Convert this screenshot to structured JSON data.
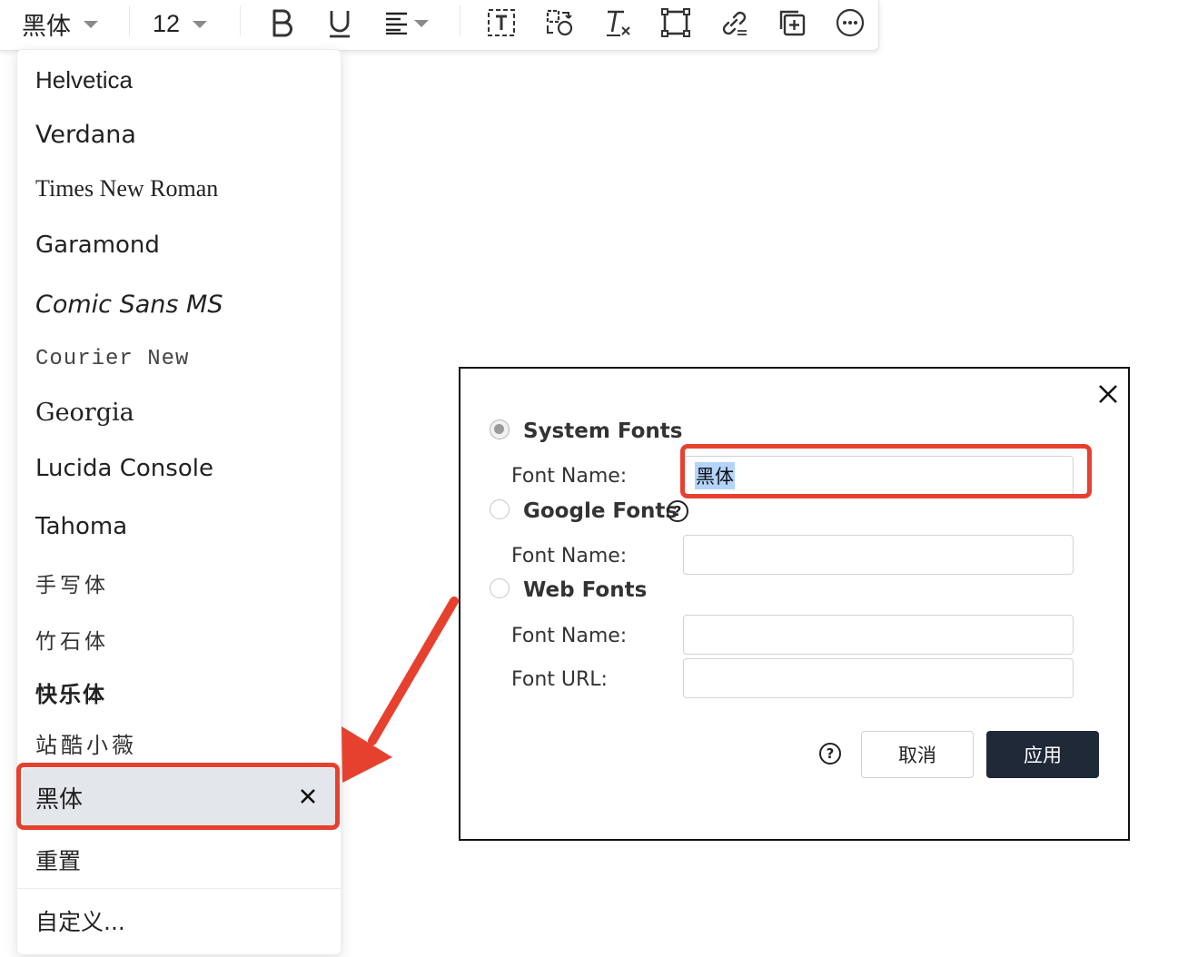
{
  "toolbar": {
    "font_value": "黑体",
    "size_value": "12",
    "icons": [
      "bold-icon",
      "underline-icon",
      "align-left-icon",
      "text-box-icon",
      "replace-icon",
      "clear-format-icon",
      "frame-icon",
      "link-icon",
      "add-copy-icon",
      "more-icon"
    ]
  },
  "font_menu": {
    "items": [
      {
        "label": "Helvetica",
        "family": "Liberation Sans"
      },
      {
        "label": "Verdana",
        "family": "DejaVu Sans"
      },
      {
        "label": "Times New Roman",
        "family": "Liberation Serif"
      },
      {
        "label": "Garamond",
        "family": "DejaVu Sans"
      },
      {
        "label": "Comic Sans MS",
        "family": "DejaVu Sans"
      },
      {
        "label": "Courier New",
        "family": "Liberation Mono"
      },
      {
        "label": "Georgia",
        "family": "DejaVu Serif"
      },
      {
        "label": "Lucida Console",
        "family": "DejaVu Sans"
      },
      {
        "label": "Tahoma",
        "family": "DejaVu Sans"
      },
      {
        "label": "手写体",
        "family": "DejaVu Sans"
      },
      {
        "label": "竹石体",
        "family": "DejaVu Sans"
      },
      {
        "label": "快乐体",
        "family": "DejaVu Sans"
      },
      {
        "label": "站酷小薇",
        "family": "DejaVu Sans"
      }
    ],
    "selected": "黑体",
    "reset": "重置",
    "custom": "自定义..."
  },
  "dialog": {
    "system_fonts": {
      "title": "System Fonts",
      "font_name_label": "Font Name:",
      "font_name_value": "黑体",
      "checked": true
    },
    "google_fonts": {
      "title": "Google Fonts",
      "font_name_label": "Font Name:",
      "font_name_value": "",
      "checked": false
    },
    "web_fonts": {
      "title": "Web Fonts",
      "font_name_label": "Font Name:",
      "font_name_value": "",
      "font_url_label": "Font URL:",
      "font_url_value": "",
      "checked": false
    },
    "help_symbol": "?",
    "cancel_label": "取消",
    "apply_label": "应用"
  },
  "colors": {
    "highlight": "#e6412f",
    "apply_bg": "#1f2937",
    "selected_bg": "#e3e6ea"
  }
}
